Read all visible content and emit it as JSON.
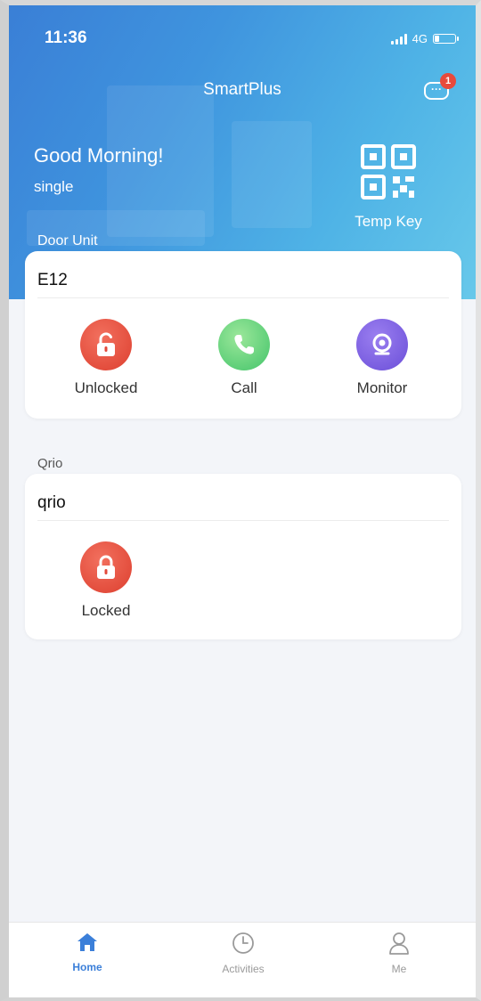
{
  "status_bar": {
    "time": "11:36",
    "network": "4G"
  },
  "header": {
    "app_title": "SmartPlus",
    "message_badge": "1",
    "greeting": "Good Morning!",
    "username": "single",
    "temp_key_label": "Temp Key"
  },
  "door_unit": {
    "section_label": "Door Unit",
    "device_name": "E12",
    "actions": [
      {
        "label": "Unlocked",
        "icon": "lock-open-icon",
        "color": "#e2493a"
      },
      {
        "label": "Call",
        "icon": "phone-icon",
        "color": "#55cc72"
      },
      {
        "label": "Monitor",
        "icon": "camera-icon",
        "color": "#7b5be0"
      }
    ]
  },
  "qrio": {
    "section_label": "Qrio",
    "device_name": "qrio",
    "actions": [
      {
        "label": "Locked",
        "icon": "lock-closed-icon",
        "color": "#e2493a"
      }
    ]
  },
  "tabbar": {
    "tabs": [
      {
        "label": "Home",
        "icon": "home-icon",
        "active": true
      },
      {
        "label": "Activities",
        "icon": "clock-icon",
        "active": false
      },
      {
        "label": "Me",
        "icon": "person-icon",
        "active": false
      }
    ],
    "active_color": "#3b7fd9"
  }
}
